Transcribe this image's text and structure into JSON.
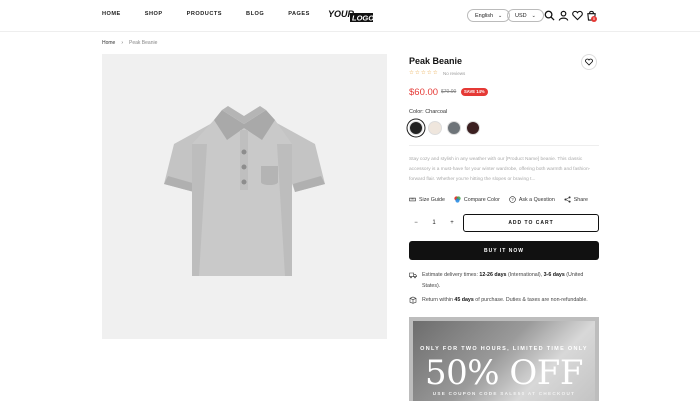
{
  "nav": {
    "items": [
      "HOME",
      "SHOP",
      "PRODUCTS",
      "BLOG",
      "PAGES"
    ]
  },
  "logo": {
    "text_top": "YOUR",
    "text_bottom": "LOGO"
  },
  "header": {
    "language": "English",
    "currency": "USD",
    "cart_count": "0"
  },
  "breadcrumb": {
    "home": "Home",
    "current": "Peak Beanie"
  },
  "product": {
    "title": "Peak Beanie",
    "stars": "☆☆☆☆☆",
    "reviews": "No reviews",
    "price": "$60.00",
    "old_price": "$70.00",
    "save_label": "SAVE 14%",
    "color_label": "Color:",
    "color_value": "Charcoal",
    "swatches": [
      "#222222",
      "#efe6dd",
      "#6e7479",
      "#3b1f20"
    ],
    "description": "Stay cozy and stylish in any weather with our [Product Name] beanie. This classic accessory is a must-have for your winter wardrobe, offering both warmth and fashion-forward flair. Whether you're hitting the slopes or braving t..."
  },
  "actions": {
    "size_guide": "Size Guide",
    "compare_color": "Compare Color",
    "ask_question": "Ask a Question",
    "share": "Share",
    "qty_minus": "−",
    "qty_value": "1",
    "qty_plus": "+",
    "add_to_cart": "ADD TO CART",
    "buy_now": "BUY IT NOW"
  },
  "shipping": {
    "prefix": "Estimate delivery times: ",
    "intl_days": "12-26 days",
    "intl_label": " (International), ",
    "us_days": "3-6 days",
    "us_label": " (United States)."
  },
  "returns": {
    "prefix": "Return within ",
    "days": "45 days",
    "suffix": " of purchase. Duties & taxes are non-refundable."
  },
  "promo": {
    "line1": "ONLY FOR TWO HOURS, LIMITED TIME ONLY",
    "headline": "50% OFF",
    "line2": "USE COUPON CODE SALE50 AT CHECKOUT"
  },
  "colors": {
    "accent": "#e53935",
    "star": "#e6a23c",
    "primary": "#111111"
  }
}
